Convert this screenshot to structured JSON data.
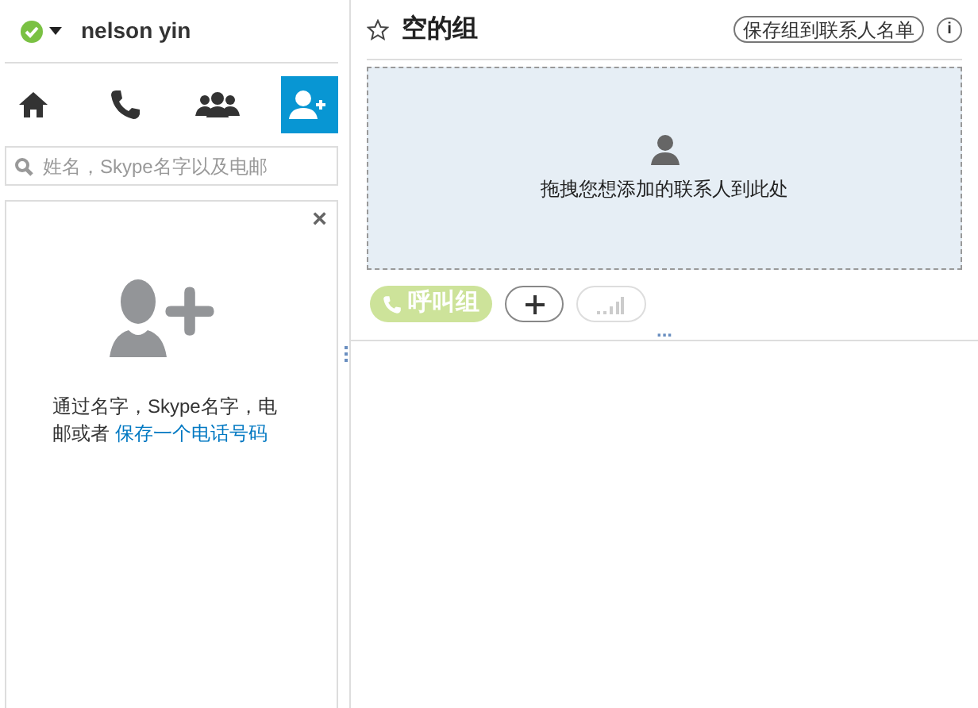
{
  "profile": {
    "name": "nelson yin"
  },
  "nav_tabs": [
    {
      "kind": "home",
      "selected": false
    },
    {
      "kind": "call",
      "selected": false
    },
    {
      "kind": "contacts",
      "selected": false
    },
    {
      "kind": "add-contact",
      "selected": true
    }
  ],
  "search": {
    "placeholder": "姓名，Skype名字以及电邮"
  },
  "add_contact_card": {
    "close": "×",
    "text": "通过名字，Skype名字，电邮或者",
    "link": "保存一个电话号码"
  },
  "group": {
    "title": "空的组",
    "favorite": false,
    "save_button": "保存组到联系人名单",
    "info": "i"
  },
  "drop_zone": {
    "text": "拖拽您想添加的联系人到此处"
  },
  "actions": [
    {
      "kind": "call",
      "label": "呼叫组",
      "disabled": true
    },
    {
      "kind": "add",
      "disabled": false
    },
    {
      "kind": "signal",
      "disabled": true
    }
  ],
  "splitter": "..."
}
